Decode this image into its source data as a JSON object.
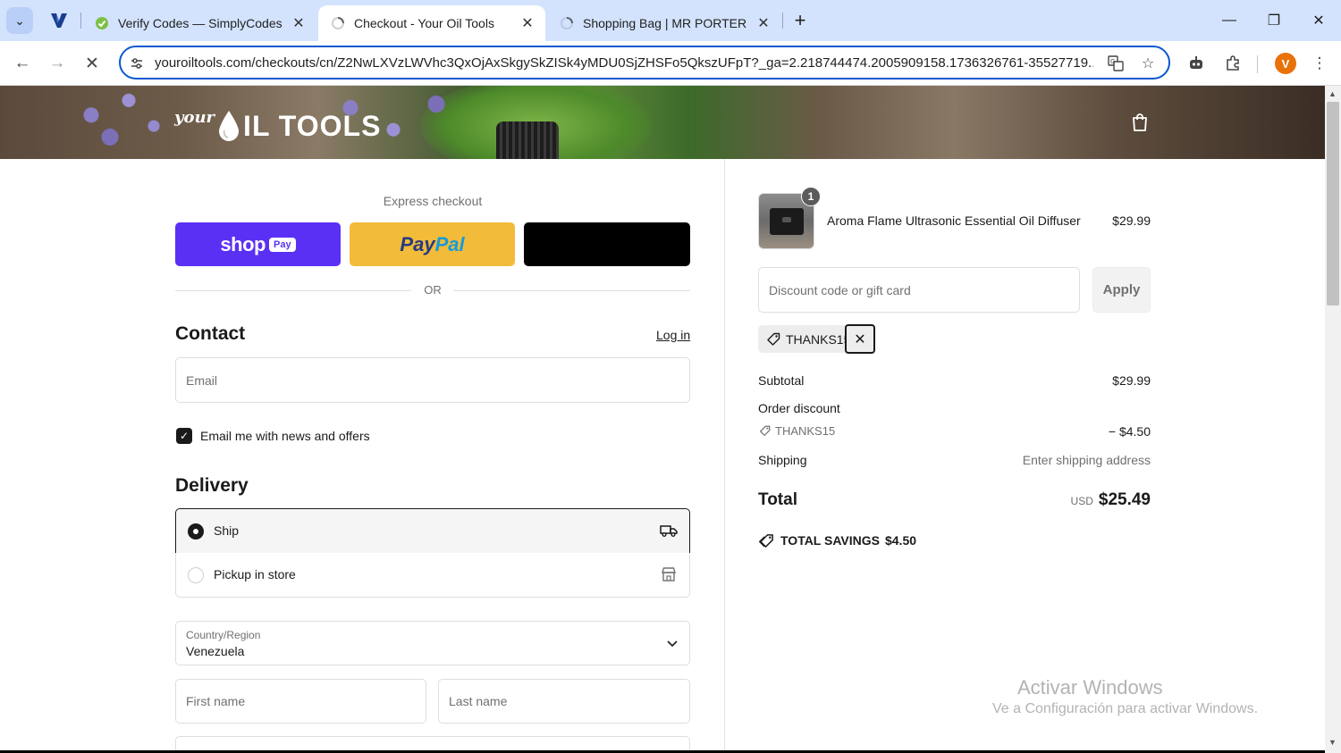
{
  "browser": {
    "tabs": [
      {
        "title": "Verify Codes — SimplyCodes",
        "favicon": "check-leaf-icon"
      },
      {
        "title": "Checkout - Your Oil Tools",
        "favicon": "loading-icon",
        "active": true
      },
      {
        "title": "Shopping Bag | MR PORTER",
        "favicon": "loading-icon"
      }
    ],
    "url": "youroiltools.com/checkouts/cn/Z2NwLXVzLWVhc3QxOjAxSkgySkZISk4yMDU0SjZHSFo5QkszUFpT?_ga=2.218744474.2005909158.1736326761-35527719...",
    "avatar_letter": "V"
  },
  "header": {
    "logo_your": "your",
    "logo_brand": "IL TOOLS"
  },
  "express": {
    "label": "Express checkout",
    "shop_word": "shop",
    "shop_pay": "Pay",
    "paypal_a": "Pay",
    "paypal_b": "Pal",
    "or": "OR"
  },
  "contact": {
    "title": "Contact",
    "login": "Log in",
    "email_placeholder": "Email",
    "news_label": "Email me with news and offers"
  },
  "delivery": {
    "title": "Delivery",
    "ship": "Ship",
    "pickup": "Pickup in store",
    "country_label": "Country/Region",
    "country_value": "Venezuela",
    "first_name": "First name",
    "last_name": "Last name"
  },
  "summary": {
    "product_name": "Aroma Flame Ultrasonic Essential Oil Diffuser",
    "product_price": "$29.99",
    "quantity": "1",
    "discount_placeholder": "Discount code or gift card",
    "apply": "Apply",
    "applied_code": "THANKS15",
    "subtotal_label": "Subtotal",
    "subtotal_value": "$29.99",
    "order_discount_label": "Order discount",
    "discount_code": "THANKS15",
    "discount_value": "− $4.50",
    "shipping_label": "Shipping",
    "shipping_value": "Enter shipping address",
    "total_label": "Total",
    "currency": "USD",
    "total_value": "$25.49",
    "savings_label": "TOTAL SAVINGS",
    "savings_value": "$4.50"
  },
  "watermark": {
    "line1": "Activar Windows",
    "line2": "Ve a Configuración para activar Windows."
  }
}
